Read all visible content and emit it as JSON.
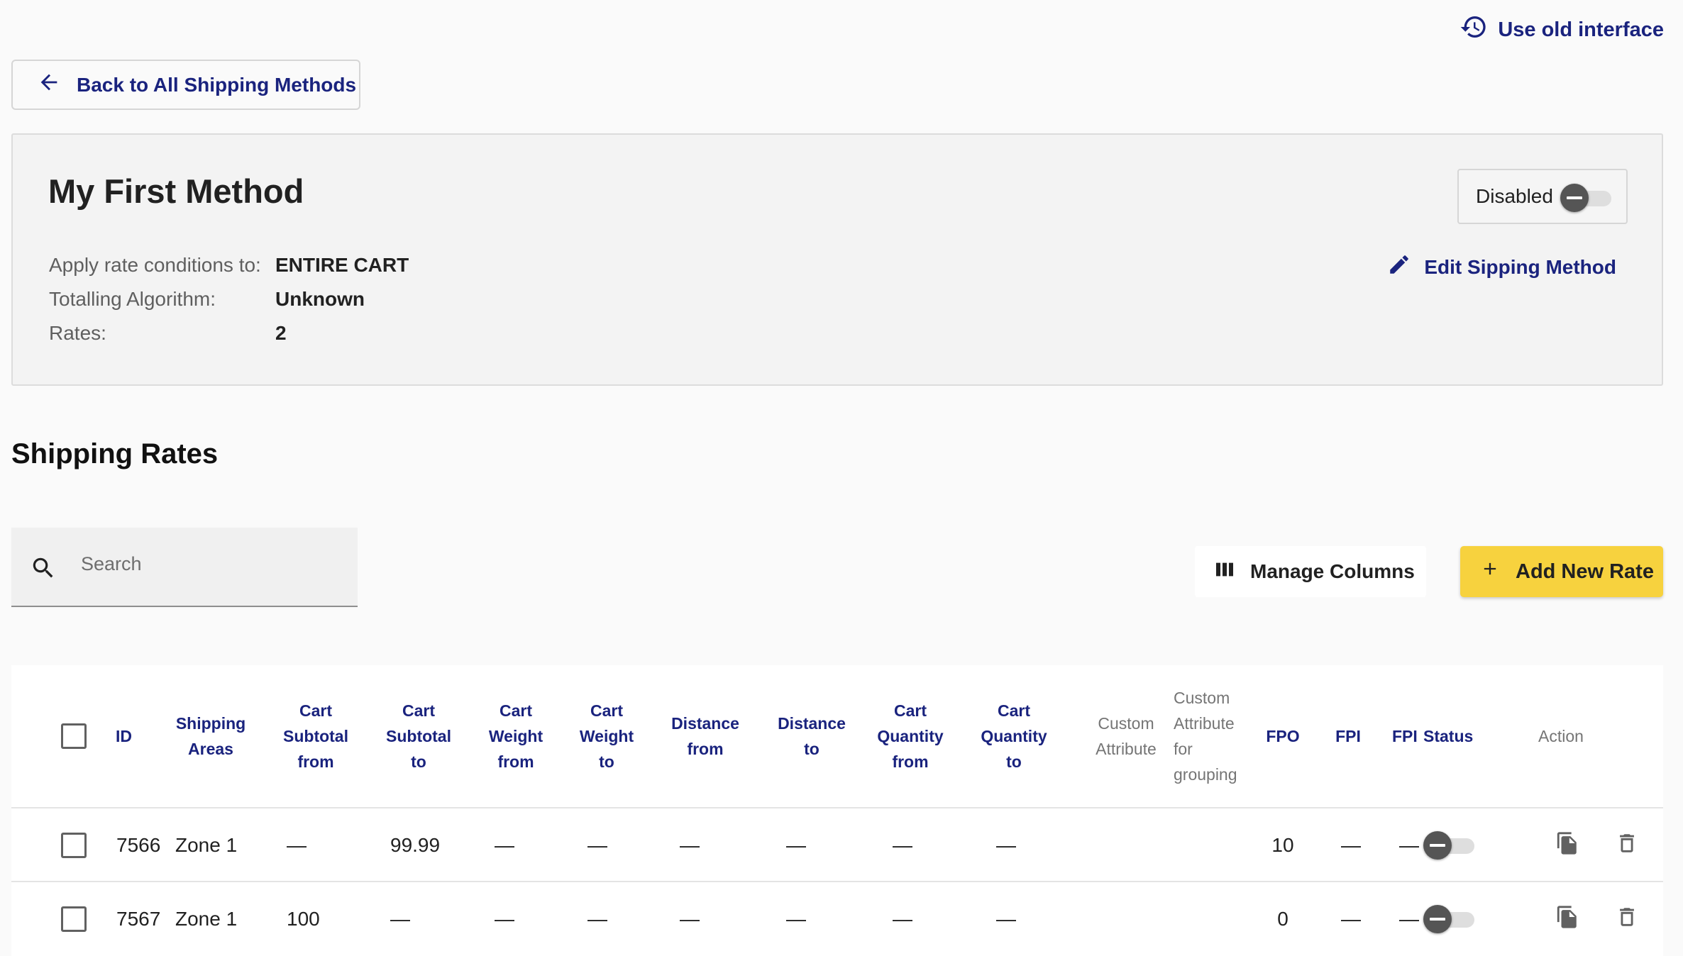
{
  "top_link": {
    "label": "Use old interface"
  },
  "back_button": {
    "label": "Back to All Shipping Methods"
  },
  "method": {
    "title": "My First Method",
    "status_label": "Disabled",
    "enabled": false,
    "edit_label": "Edit Sipping Method",
    "meta": [
      {
        "label": "Apply rate conditions to:",
        "value": "ENTIRE CART"
      },
      {
        "label": "Totalling Algorithm:",
        "value": "Unknown"
      },
      {
        "label": "Rates:",
        "value": "2"
      }
    ]
  },
  "rates": {
    "heading": "Shipping Rates",
    "search_placeholder": "Search",
    "manage_columns_label": "Manage Columns",
    "add_rate_label": "Add New Rate",
    "columns": {
      "id": "ID",
      "areas": "Shipping Areas",
      "subtotal_from": "Cart Subtotal from",
      "subtotal_to": "Cart Subtotal to",
      "weight_from": "Cart Weight from",
      "weight_to": "Cart Weight to",
      "distance_from": "Distance from",
      "distance_to": "Distance to",
      "qty_from": "Cart Quantity from",
      "qty_to": "Cart Quantity to",
      "custom_attr": "Custom Attribute",
      "custom_attr_group": "Custom Attribute for grouping",
      "fpo": "FPO",
      "fpi": "FPI",
      "fpi2": "FPI",
      "status": "Status",
      "action": "Action"
    },
    "rows": [
      {
        "id": "7566",
        "areas": "Zone 1",
        "subtotal_from": "—",
        "subtotal_to": "99.99",
        "weight_from": "—",
        "weight_to": "—",
        "distance_from": "—",
        "distance_to": "—",
        "qty_from": "—",
        "qty_to": "—",
        "custom_attr": "",
        "custom_attr_group": "",
        "fpo": "10",
        "fpi": "—",
        "fpi2": "—",
        "enabled": false
      },
      {
        "id": "7567",
        "areas": "Zone 1",
        "subtotal_from": "100",
        "subtotal_to": "—",
        "weight_from": "—",
        "weight_to": "—",
        "distance_from": "—",
        "distance_to": "—",
        "qty_from": "—",
        "qty_to": "—",
        "custom_attr": "",
        "custom_attr_group": "",
        "fpo": "0",
        "fpi": "—",
        "fpi2": "—",
        "enabled": false
      }
    ]
  }
}
